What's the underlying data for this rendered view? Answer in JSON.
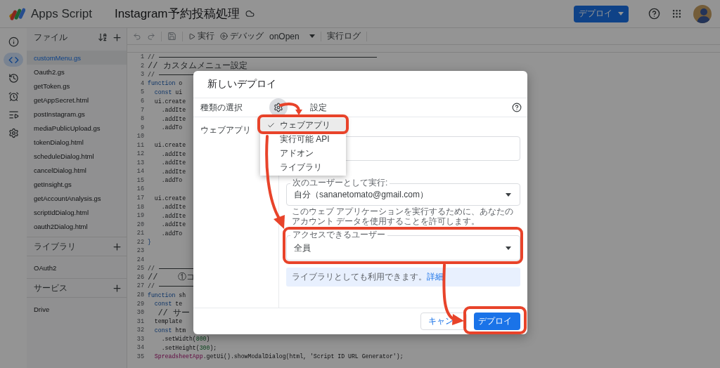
{
  "header": {
    "app_name": "Apps Script",
    "project_title": "Instagram予約投稿処理",
    "deploy_button": "デプロイ"
  },
  "rail": [
    {
      "kind": "info",
      "selected": false
    },
    {
      "kind": "code",
      "selected": true
    },
    {
      "kind": "history",
      "selected": false
    },
    {
      "kind": "triggers",
      "selected": false
    },
    {
      "kind": "executions",
      "selected": false
    },
    {
      "kind": "settings",
      "selected": false
    }
  ],
  "toolbar": {
    "run": "実行",
    "debug": "デバッグ",
    "function": "onOpen",
    "log": "実行ログ"
  },
  "files": {
    "heading": "ファイル",
    "items": [
      {
        "name": "customMenu.gs",
        "selected": true
      },
      {
        "name": "Oauth2.gs",
        "selected": false
      },
      {
        "name": "getToken.gs",
        "selected": false
      },
      {
        "name": "getAppSecret.html",
        "selected": false
      },
      {
        "name": "postInstagram.gs",
        "selected": false
      },
      {
        "name": "mediaPublicUpload.gs",
        "selected": false
      },
      {
        "name": "tokenDialog.html",
        "selected": false
      },
      {
        "name": "scheduleDialog.html",
        "selected": false
      },
      {
        "name": "cancelDialog.html",
        "selected": false
      },
      {
        "name": "getInsight.gs",
        "selected": false
      },
      {
        "name": "getAccountAnalysis.gs",
        "selected": false
      },
      {
        "name": "scriptIdDialog.html",
        "selected": false
      },
      {
        "name": "oauth2Dialog.html",
        "selected": false
      }
    ]
  },
  "libraries": {
    "heading": "ライブラリ",
    "items": [
      "OAuth2"
    ]
  },
  "services": {
    "heading": "サービス",
    "items": [
      "Drive"
    ]
  },
  "code_lines": [
    {
      "number": "1",
      "rule": true,
      "tokens": [
        {
          "kind": "comment",
          "text": "//"
        }
      ]
    },
    {
      "number": "2",
      "tokens": [
        {
          "kind": "comment",
          "text": "// カスタムメニュー設定"
        }
      ]
    },
    {
      "number": "3",
      "rule": true,
      "tokens": [
        {
          "kind": "comment",
          "text": "//"
        }
      ]
    },
    {
      "number": "4",
      "tokens": [
        {
          "kind": "keyword",
          "text": "function"
        },
        {
          "kind": "plain",
          "text": " o"
        }
      ]
    },
    {
      "number": "5",
      "tokens": [
        {
          "kind": "keyword",
          "text": "  const"
        },
        {
          "kind": "plain",
          "text": " ui"
        }
      ]
    },
    {
      "number": "6",
      "tokens": [
        {
          "kind": "plain",
          "text": "  ui.create"
        }
      ]
    },
    {
      "number": "7",
      "tokens": [
        {
          "kind": "plain",
          "text": "    .addIte"
        }
      ]
    },
    {
      "number": "8",
      "tokens": [
        {
          "kind": "plain",
          "text": "    .addIte"
        }
      ]
    },
    {
      "number": "9",
      "tokens": [
        {
          "kind": "plain",
          "text": "    .addTo"
        }
      ]
    },
    {
      "number": "10"
    },
    {
      "number": "11",
      "tokens": [
        {
          "kind": "plain",
          "text": "  ui.create"
        }
      ]
    },
    {
      "number": "12",
      "tokens": [
        {
          "kind": "plain",
          "text": "    .addIte"
        }
      ]
    },
    {
      "number": "13",
      "tokens": [
        {
          "kind": "plain",
          "text": "    .addIte"
        }
      ]
    },
    {
      "number": "14",
      "tokens": [
        {
          "kind": "plain",
          "text": "    .addIte"
        }
      ]
    },
    {
      "number": "15",
      "tokens": [
        {
          "kind": "plain",
          "text": "    .addTo"
        }
      ]
    },
    {
      "number": "16"
    },
    {
      "number": "17",
      "tokens": [
        {
          "kind": "plain",
          "text": "  ui.create"
        }
      ]
    },
    {
      "number": "18",
      "tokens": [
        {
          "kind": "plain",
          "text": "    .addIte"
        }
      ]
    },
    {
      "number": "19",
      "tokens": [
        {
          "kind": "plain",
          "text": "    .addIte"
        }
      ]
    },
    {
      "number": "20",
      "tokens": [
        {
          "kind": "plain",
          "text": "    .addIte"
        }
      ]
    },
    {
      "number": "21",
      "tokens": [
        {
          "kind": "plain",
          "text": "    .addTo"
        }
      ]
    },
    {
      "number": "22",
      "tokens": [
        {
          "kind": "keyword",
          "text": "}"
        }
      ]
    },
    {
      "number": "23"
    },
    {
      "number": "24"
    },
    {
      "number": "25",
      "rule": true,
      "tokens": [
        {
          "kind": "comment",
          "text": "//"
        }
      ]
    },
    {
      "number": "26",
      "tokens": [
        {
          "kind": "comment",
          "text": "//    ①コ"
        }
      ]
    },
    {
      "number": "27",
      "rule": true,
      "tokens": [
        {
          "kind": "comment",
          "text": "//"
        }
      ]
    },
    {
      "number": "28",
      "tokens": [
        {
          "kind": "keyword",
          "text": "function"
        },
        {
          "kind": "plain",
          "text": " sh"
        }
      ]
    },
    {
      "number": "29",
      "tokens": [
        {
          "kind": "keyword",
          "text": "  const"
        },
        {
          "kind": "plain",
          "text": " te"
        }
      ]
    },
    {
      "number": "30",
      "tokens": [
        {
          "kind": "comment",
          "text": "  // サー"
        }
      ]
    },
    {
      "number": "31",
      "tokens": [
        {
          "kind": "plain",
          "text": "  template"
        }
      ]
    },
    {
      "number": "32",
      "tokens": [
        {
          "kind": "keyword",
          "text": "  const"
        },
        {
          "kind": "plain",
          "text": " htm"
        }
      ]
    },
    {
      "number": "33",
      "tokens": [
        {
          "kind": "plain",
          "text": "    .setWidth("
        },
        {
          "kind": "number",
          "text": "800"
        },
        {
          "kind": "plain",
          "text": ")"
        }
      ]
    },
    {
      "number": "34",
      "tokens": [
        {
          "kind": "plain",
          "text": "    .setHeight("
        },
        {
          "kind": "number",
          "text": "300"
        },
        {
          "kind": "plain",
          "text": ");"
        }
      ]
    },
    {
      "number": "35",
      "tokens": [
        {
          "kind": "class",
          "text": "  SpreadsheetApp"
        },
        {
          "kind": "plain",
          "text": ".getUi().showModalDialog(html, 'Script ID URL Generator');"
        }
      ]
    }
  ],
  "dialog": {
    "title": "新しいデプロイ",
    "type_label": "種類の選択",
    "settings_label": "設定",
    "selected_type": "ウェブアプリ",
    "type_menu": [
      {
        "label": "ウェブアプリ",
        "selected": true
      },
      {
        "label": "実行可能 API",
        "selected": false
      },
      {
        "label": "アドオン",
        "selected": false
      },
      {
        "label": "ライブラリ",
        "selected": false
      }
    ],
    "run_as": {
      "label": "次のユーザーとして実行:",
      "value": "自分（sananetomato@gmail.com）"
    },
    "run_as_note": "このウェブ アプリケーションを実行するために、あなたのアカウント データを使用することを許可します。",
    "access": {
      "label": "アクセスできるユーザー",
      "value": "全員"
    },
    "info": {
      "text": "ライブラリとしても利用できます。",
      "link": "詳細"
    },
    "buttons": [
      {
        "label": "キャン",
        "kind": "secondary"
      },
      {
        "label": "デプロイ",
        "kind": "primary"
      }
    ]
  }
}
